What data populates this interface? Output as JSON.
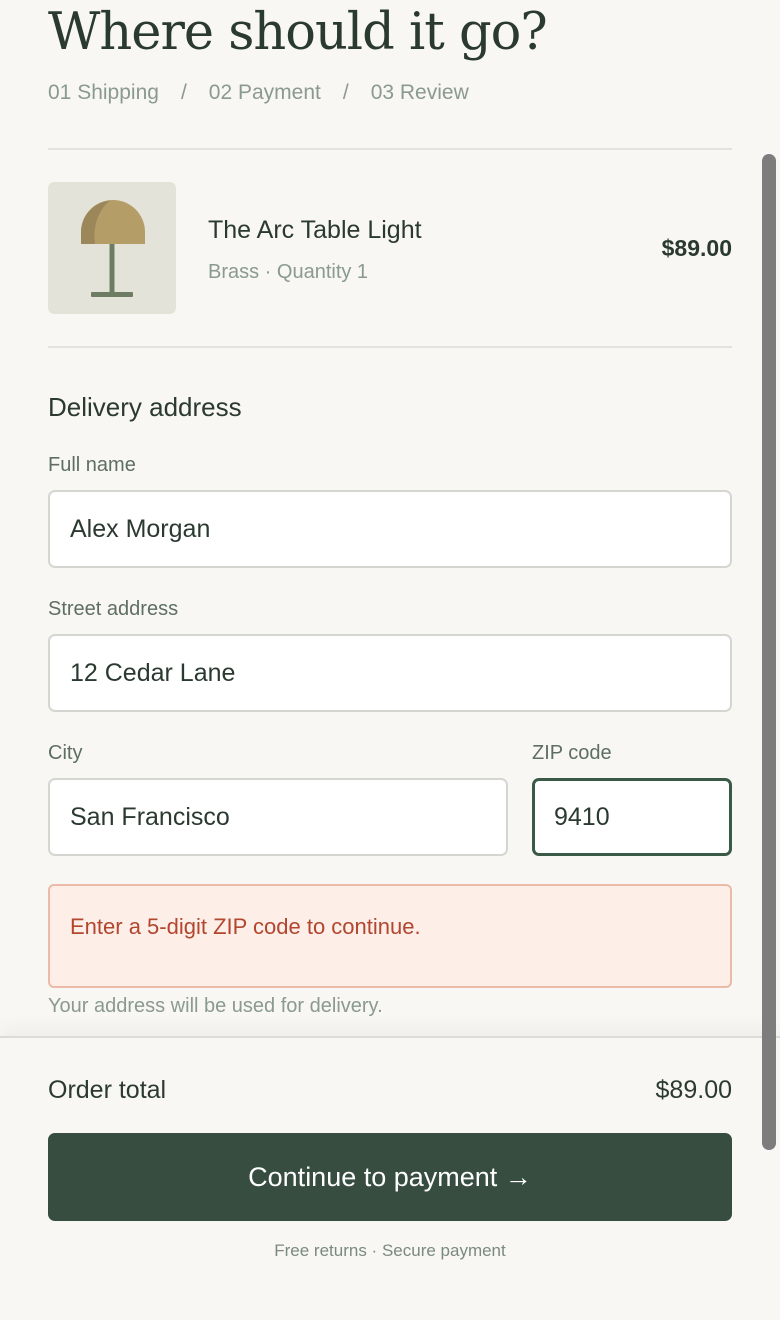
{
  "page": {
    "heading": "Where should it go?",
    "steps": [
      {
        "label": "01 Shipping"
      },
      {
        "label": "02 Payment"
      },
      {
        "label": "03 Review"
      }
    ],
    "step_separator": "/"
  },
  "product": {
    "name": "The Arc Table Light",
    "meta": "Brass · Quantity 1",
    "price": "$89.00",
    "thumbnail_icon": "table-lamp-icon"
  },
  "form": {
    "section_title": "Delivery address",
    "full_name": {
      "label": "Full name",
      "value": "Alex Morgan"
    },
    "street": {
      "label": "Street address",
      "value": "12 Cedar Lane"
    },
    "city": {
      "label": "City",
      "value": "San Francisco"
    },
    "zip": {
      "label": "ZIP code",
      "value": "9410"
    },
    "error_message": "Enter a 5-digit ZIP code to continue.",
    "helper_text": "Your address will be used for delivery."
  },
  "footer": {
    "total_label": "Order total",
    "total_value": "$89.00",
    "cta_label": "Continue to payment →",
    "fine_print": "Free returns · Secure payment"
  },
  "colors": {
    "background": "#f8f7f3",
    "primary_button": "#364d40",
    "focus_border": "#3a5a48",
    "error_text": "#b2462e",
    "error_background": "#fdeee8",
    "lamp_shade": "#b59d68",
    "lamp_stem": "#6d7d64"
  }
}
